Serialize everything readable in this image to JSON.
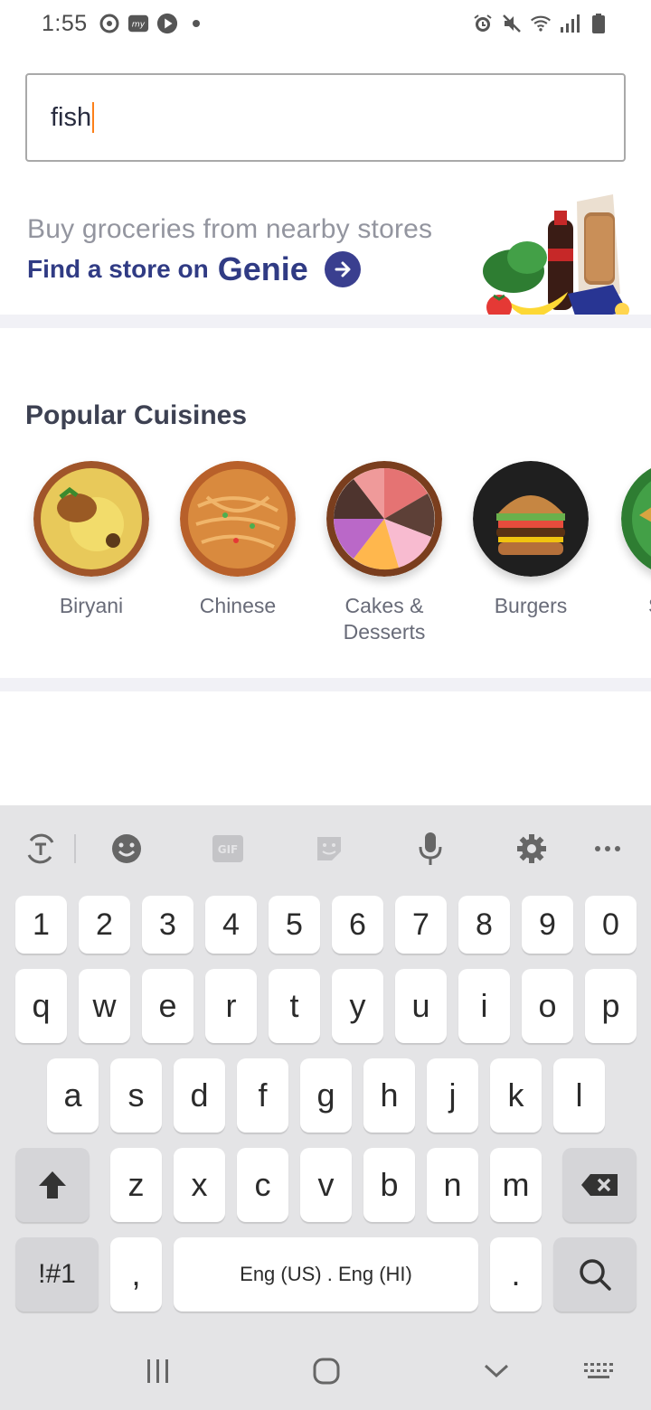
{
  "status_bar": {
    "time": "1:55",
    "left_icons": [
      "swiggy-status-icon",
      "mygate-status-icon",
      "play-status-icon",
      "dot-status-icon"
    ],
    "right_icons": [
      "alarm-icon",
      "mute-icon",
      "wifi-icon",
      "signal-icon",
      "battery-icon"
    ]
  },
  "search": {
    "value": "fish",
    "caret_color": "#fc8019"
  },
  "genie_banner": {
    "line1": "Buy groceries from nearby stores",
    "line2_prefix": "Find a store on",
    "brand": "Genie",
    "brand_color": "#303b84"
  },
  "popular_cuisines": {
    "title": "Popular Cuisines",
    "items": [
      {
        "label": "Biryani",
        "image": "biryani-image"
      },
      {
        "label": "Chinese",
        "image": "noodles-image"
      },
      {
        "label": "Cakes & Desserts",
        "image": "cakes-image"
      },
      {
        "label": "Burgers",
        "image": "burger-image"
      },
      {
        "label": "S",
        "image": "snacks-image"
      }
    ]
  },
  "keyboard": {
    "toolbar": [
      "translate-icon",
      "emoji-icon",
      "gif-icon",
      "sticker-icon",
      "mic-icon",
      "settings-icon",
      "more-icon"
    ],
    "gif_label": "GIF",
    "row_numbers": [
      "1",
      "2",
      "3",
      "4",
      "5",
      "6",
      "7",
      "8",
      "9",
      "0"
    ],
    "row1": [
      "q",
      "w",
      "e",
      "r",
      "t",
      "y",
      "u",
      "i",
      "o",
      "p"
    ],
    "row2": [
      "a",
      "s",
      "d",
      "f",
      "g",
      "h",
      "j",
      "k",
      "l"
    ],
    "row3": [
      "z",
      "x",
      "c",
      "v",
      "b",
      "n",
      "m"
    ],
    "symbols_key": "!#1",
    "comma_key": ",",
    "space_label": "Eng (US) . Eng (HI)",
    "period_key": ".",
    "action_icon": "search-icon"
  },
  "nav_bar": [
    "recents-icon",
    "home-icon",
    "back-icon",
    "keyboard-switch-icon"
  ]
}
